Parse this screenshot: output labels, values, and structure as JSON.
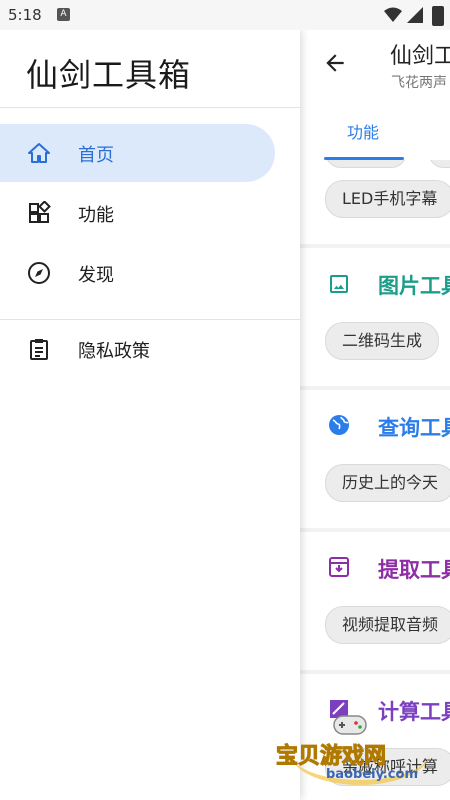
{
  "status_bar": {
    "time": "5:18",
    "notif_icon": "A"
  },
  "drawer": {
    "title": "仙剑工具箱",
    "items": [
      {
        "label": "首页",
        "icon": "home-icon",
        "active": true
      },
      {
        "label": "功能",
        "icon": "widgets-icon",
        "active": false
      },
      {
        "label": "发现",
        "icon": "compass-icon",
        "active": false
      },
      {
        "label": "隐私政策",
        "icon": "clipboard-icon",
        "active": false
      }
    ]
  },
  "background": {
    "title": "仙剑工",
    "subtitle": "飞花两声",
    "tab": "功能",
    "sections": [
      {
        "title": "",
        "chip": "LED手机字幕"
      },
      {
        "title": "图片工具",
        "chip": "二维码生成",
        "color": "#1a9e8a"
      },
      {
        "title": "查询工具",
        "chip": "历史上的今天",
        "color": "#2b7de9"
      },
      {
        "title": "提取工具",
        "chip": "视频提取音频",
        "color": "#8e2ea6"
      },
      {
        "title": "计算工具",
        "chip": "亲戚称呼计算",
        "color": "#7b3fbf"
      }
    ]
  },
  "watermark": {
    "text": "宝贝游戏网",
    "url": "baobeiy.com"
  },
  "colors": {
    "accent": "#2b6fd6",
    "active_bg": "#dce9fb"
  }
}
